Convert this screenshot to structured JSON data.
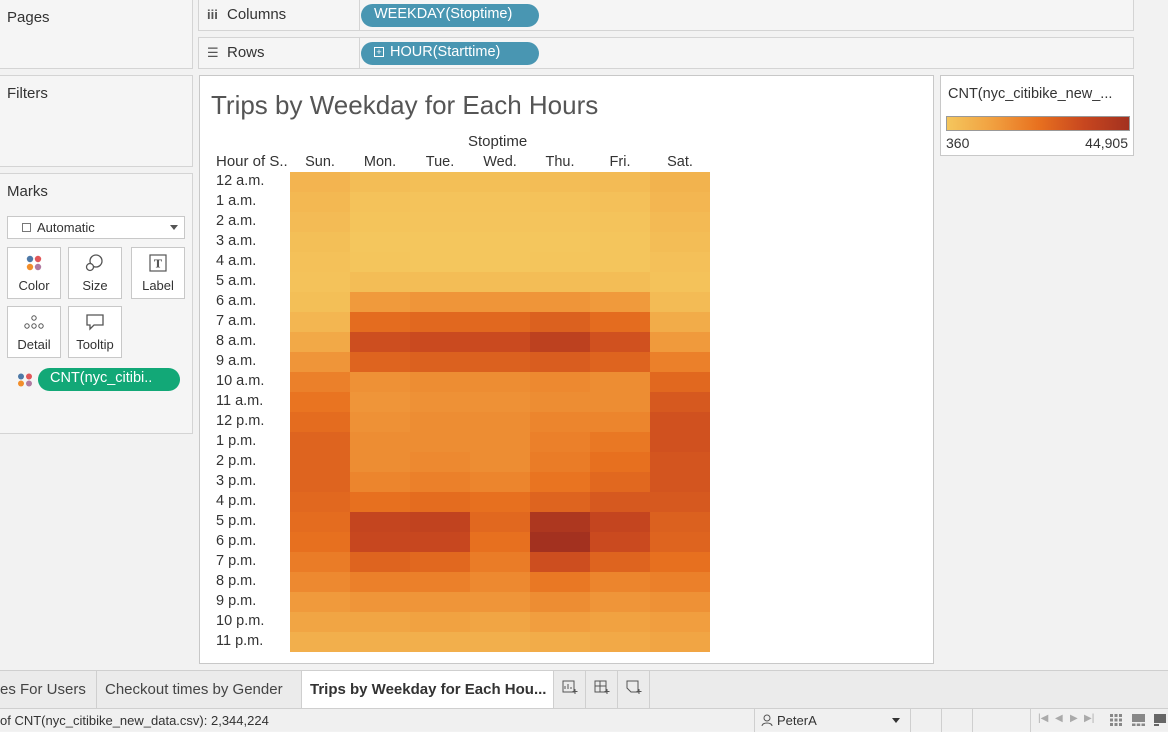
{
  "left_panel": {
    "pages_title": "Pages",
    "filters_title": "Filters",
    "marks_title": "Marks",
    "marks_type": "Automatic",
    "mark_buttons": [
      {
        "label": "Color",
        "icon": "color-icon"
      },
      {
        "label": "Size",
        "icon": "size-icon"
      },
      {
        "label": "Label",
        "icon": "label-icon"
      },
      {
        "label": "Detail",
        "icon": "detail-icon"
      },
      {
        "label": "Tooltip",
        "icon": "tooltip-icon"
      }
    ],
    "color_field": "CNT(nyc_citibi.."
  },
  "shelves": {
    "columns_label": "Columns",
    "columns_pill": "WEEKDAY(Stoptime)",
    "rows_label": "Rows",
    "rows_pill": "HOUR(Starttime)"
  },
  "sheet": {
    "title": "Trips by Weekday for Each Hours",
    "column_axis_title": "Stoptime",
    "row_axis_title": "Hour of S.."
  },
  "legend": {
    "title": "CNT(nyc_citibike_new_...",
    "min_label": "360",
    "max_label": "44,905",
    "colors": [
      "#f4c65d",
      "#f1a040",
      "#e8711f",
      "#c8471f",
      "#a3311f"
    ]
  },
  "chart_data": {
    "type": "heatmap",
    "x_title": "Stoptime",
    "y_title": "Hour of S..",
    "columns": [
      "Sun.",
      "Mon.",
      "Tue.",
      "Wed.",
      "Thu.",
      "Fri.",
      "Sat."
    ],
    "rows": [
      "12 a.m.",
      "1 a.m.",
      "2 a.m.",
      "3 a.m.",
      "4 a.m.",
      "5 a.m.",
      "6 a.m.",
      "7 a.m.",
      "8 a.m.",
      "9 a.m.",
      "10 a.m.",
      "11 a.m.",
      "12 p.m.",
      "1 p.m.",
      "2 p.m.",
      "3 p.m.",
      "4 p.m.",
      "5 p.m.",
      "6 p.m.",
      "7 p.m.",
      "8 p.m.",
      "9 p.m.",
      "10 p.m.",
      "11 p.m."
    ],
    "value_range": [
      360,
      44905
    ],
    "values": [
      [
        5500,
        3000,
        2500,
        2500,
        3000,
        3500,
        6000
      ],
      [
        4500,
        1500,
        1200,
        1200,
        1500,
        2000,
        5000
      ],
      [
        3500,
        1000,
        800,
        800,
        900,
        1200,
        4000
      ],
      [
        2500,
        500,
        400,
        400,
        500,
        700,
        3000
      ],
      [
        1800,
        600,
        500,
        500,
        600,
        700,
        2000
      ],
      [
        1500,
        3000,
        3000,
        3000,
        3000,
        3000,
        1500
      ],
      [
        2500,
        13000,
        14000,
        14000,
        14000,
        13000,
        3500
      ],
      [
        5000,
        24000,
        25000,
        25000,
        27000,
        24000,
        8000
      ],
      [
        9000,
        32000,
        33000,
        33000,
        37000,
        31000,
        13000
      ],
      [
        14000,
        26000,
        27000,
        27000,
        28000,
        26000,
        19000
      ],
      [
        19000,
        15000,
        16000,
        16000,
        17000,
        16000,
        25000
      ],
      [
        22000,
        14000,
        15000,
        15000,
        16000,
        16000,
        29000
      ],
      [
        24000,
        15000,
        16000,
        16000,
        18000,
        18000,
        31000
      ],
      [
        26000,
        16000,
        16000,
        16000,
        19000,
        21000,
        31000
      ],
      [
        26000,
        16000,
        17000,
        16000,
        20000,
        23000,
        30000
      ],
      [
        26000,
        18000,
        19000,
        18000,
        22000,
        25000,
        30000
      ],
      [
        25000,
        23000,
        24000,
        23000,
        26000,
        29000,
        29000
      ],
      [
        24000,
        35000,
        36000,
        25000,
        42000,
        35000,
        27000
      ],
      [
        23000,
        34000,
        34000,
        23000,
        44905,
        33000,
        26000
      ],
      [
        20000,
        26000,
        25000,
        20000,
        32000,
        26000,
        23000
      ],
      [
        17000,
        19000,
        19000,
        17000,
        21000,
        18000,
        19000
      ],
      [
        13000,
        14000,
        14000,
        14000,
        16000,
        14000,
        15000
      ],
      [
        10000,
        10000,
        11000,
        10000,
        12000,
        11000,
        12000
      ],
      [
        7000,
        7000,
        7000,
        7000,
        8000,
        9000,
        10000
      ]
    ]
  },
  "tabs": {
    "items": [
      "es For Users",
      "Checkout times by Gender",
      "Trips by Weekday for Each Hou..."
    ],
    "active_index": 2,
    "icons": [
      "new-worksheet-icon",
      "new-dashboard-icon",
      "new-story-icon"
    ]
  },
  "status": {
    "text": "of CNT(nyc_citibike_new_data.csv): 2,344,224",
    "user": "PeterA"
  }
}
